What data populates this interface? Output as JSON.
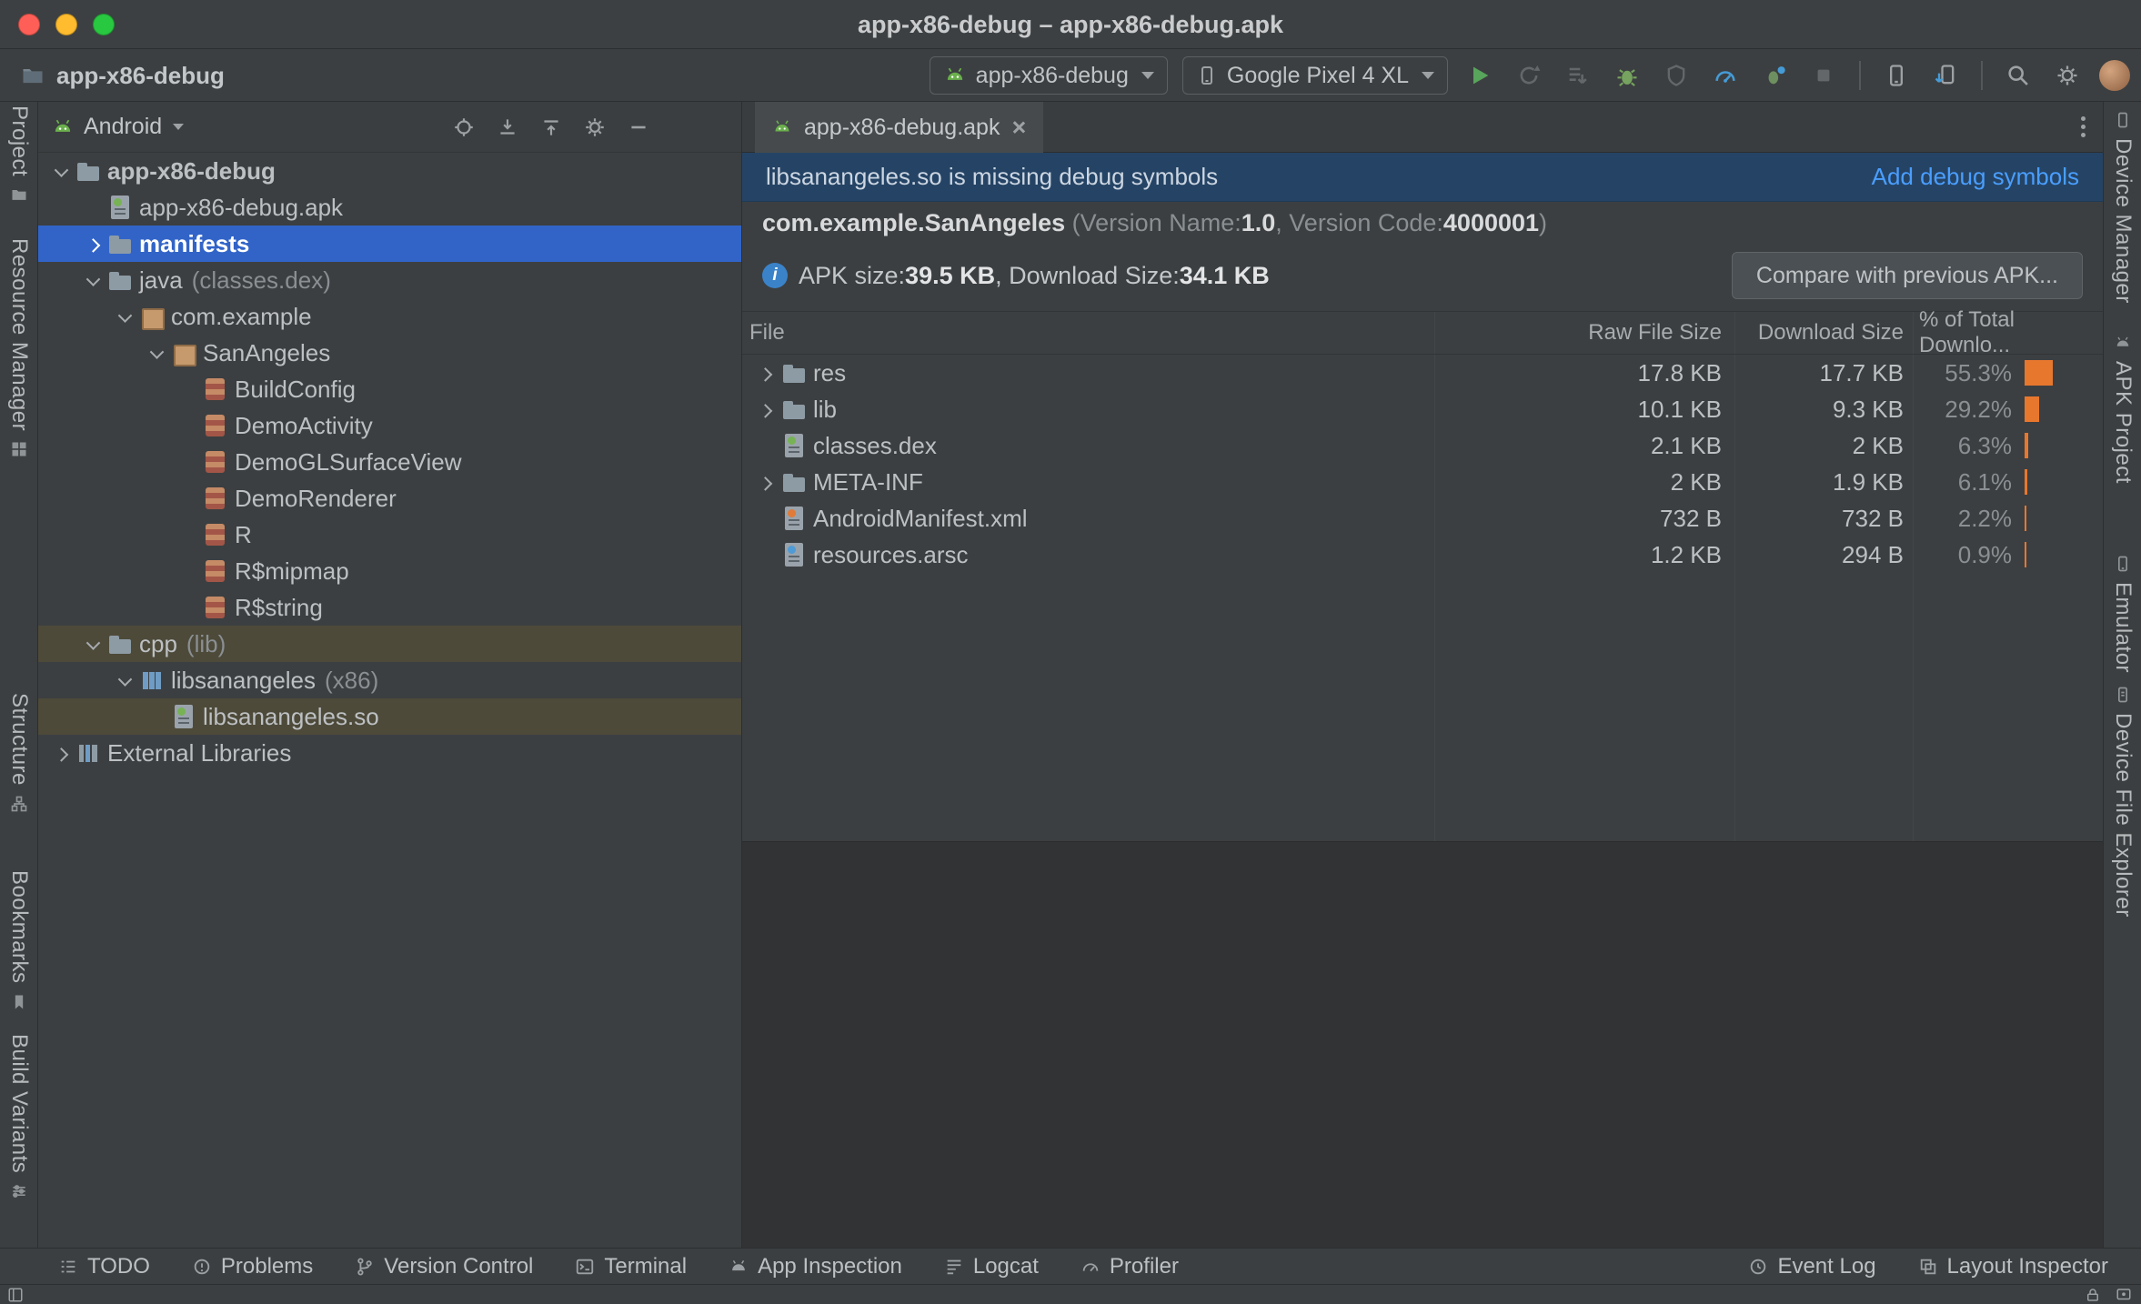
{
  "window": {
    "title": "app-x86-debug – app-x86-debug.apk"
  },
  "toolbar": {
    "project": "app-x86-debug",
    "run_config": "app-x86-debug",
    "device": "Google Pixel 4 XL"
  },
  "left_stripe": {
    "items": [
      "Project",
      "Resource Manager",
      "Structure",
      "Bookmarks",
      "Build Variants"
    ]
  },
  "right_stripe": {
    "items": [
      "Device Manager",
      "APK Project",
      "Emulator",
      "Device File Explorer"
    ]
  },
  "project_panel": {
    "view_selector": "Android",
    "tree": {
      "rows": [
        {
          "label": "app-x86-debug"
        },
        {
          "label": "app-x86-debug.apk"
        },
        {
          "label": "manifests"
        },
        {
          "label": "java",
          "suffix": "(classes.dex)"
        },
        {
          "label": "com.example"
        },
        {
          "label": "SanAngeles"
        },
        {
          "label": "BuildConfig"
        },
        {
          "label": "DemoActivity"
        },
        {
          "label": "DemoGLSurfaceView"
        },
        {
          "label": "DemoRenderer"
        },
        {
          "label": "R"
        },
        {
          "label": "R$mipmap"
        },
        {
          "label": "R$string"
        },
        {
          "label": "cpp",
          "suffix": "(lib)"
        },
        {
          "label": "libsanangeles",
          "suffix": "(x86)"
        },
        {
          "label": "libsanangeles.so"
        },
        {
          "label": "External Libraries"
        }
      ]
    }
  },
  "editor": {
    "tab": "app-x86-debug.apk",
    "banner": {
      "message": "libsanangeles.so is missing debug symbols",
      "action": "Add debug symbols"
    },
    "apk_info": {
      "package": "com.example.SanAngeles",
      "version_name_label": "(Version Name: ",
      "version_name": "1.0",
      "version_code_label": ", Version Code: ",
      "version_code": "4000001",
      "paren_close": ")",
      "size_label": "APK size: ",
      "size_value": "39.5 KB",
      "download_label": ", Download Size: ",
      "download_value": "34.1 KB",
      "compare_button": "Compare with previous APK..."
    },
    "table": {
      "columns": [
        "File",
        "Raw File Size",
        "Download Size",
        "% of Total Downlo..."
      ],
      "rows": [
        {
          "file": "res",
          "raw": "17.8 KB",
          "download": "17.7 KB",
          "percent": "55.3%",
          "pct": 55.3
        },
        {
          "file": "lib",
          "raw": "10.1 KB",
          "download": "9.3 KB",
          "percent": "29.2%",
          "pct": 29.2
        },
        {
          "file": "classes.dex",
          "raw": "2.1 KB",
          "download": "2 KB",
          "percent": "6.3%",
          "pct": 6.3
        },
        {
          "file": "META-INF",
          "raw": "2 KB",
          "download": "1.9 KB",
          "percent": "6.1%",
          "pct": 6.1
        },
        {
          "file": "AndroidManifest.xml",
          "raw": "732 B",
          "download": "732 B",
          "percent": "2.2%",
          "pct": 2.2
        },
        {
          "file": "resources.arsc",
          "raw": "1.2 KB",
          "download": "294 B",
          "percent": "0.9%",
          "pct": 0.9
        }
      ]
    }
  },
  "status_bar": {
    "left": [
      "TODO",
      "Problems",
      "Version Control",
      "Terminal",
      "App Inspection",
      "Logcat",
      "Profiler"
    ],
    "right": [
      "Event Log",
      "Layout Inspector"
    ]
  },
  "colors": {
    "selection_blue": "#3264c8",
    "highlight_olive": "#4d4a3a",
    "banner_blue": "#254465",
    "link_blue": "#4a9eff",
    "accent_orange": "#e8772e",
    "run_green": "#58a55c"
  }
}
